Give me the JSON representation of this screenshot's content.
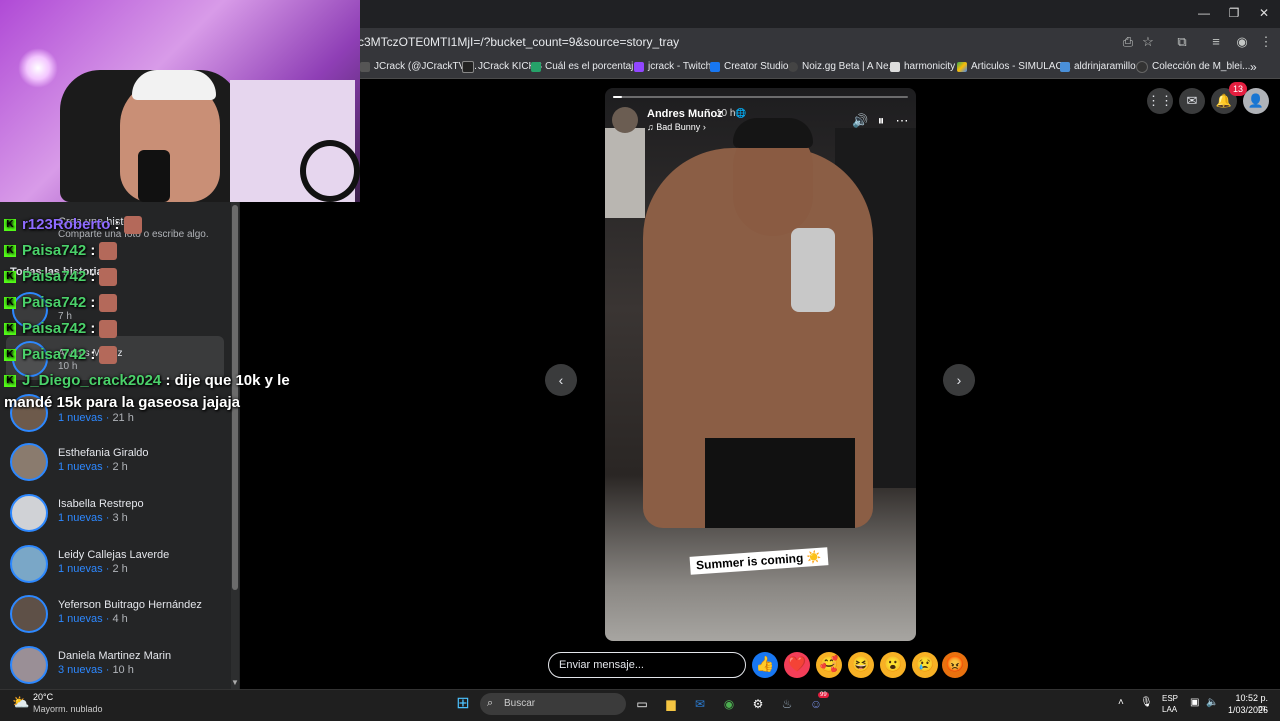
{
  "browser": {
    "url": "0Njc3MTczOTE0MTI1MjI=/?bucket_count=9&source=story_tray",
    "bookmarks": [
      "JCrack (@JCrackTV)...",
      "JCrack KICKS",
      "Cuál es el porcentaj...",
      "jcrack - Twitch",
      "Creator Studio",
      "Noiz.gg Beta | A Ne...",
      "harmonicity",
      "Articulos - SIMULAC...",
      "aldrinjaramillo",
      "Colección de M_blei..."
    ],
    "more_bookmarks": "»"
  },
  "facebook": {
    "notification_count": "13",
    "sidebar_faded": {
      "create_title": "Crea una historia",
      "create_sub": "Comparte una foto o escribe algo.",
      "all_stories": "Todas las historia",
      "row1_time": "7 h",
      "row2_name": "Andres Muñoz",
      "row2_time": "10 h"
    },
    "stories": [
      {
        "name": "",
        "new": "1 nuevas",
        "time": "21 h"
      },
      {
        "name": "Esthefania Giraldo",
        "new": "1 nuevas",
        "time": "2 h"
      },
      {
        "name": "Isabella Restrepo",
        "new": "1 nuevas",
        "time": "3 h"
      },
      {
        "name": "Leidy Callejas Laverde",
        "new": "1 nuevas",
        "time": "2 h"
      },
      {
        "name": "Yeferson Buitrago Hernández",
        "new": "1 nuevas",
        "time": "4 h"
      },
      {
        "name": "Daniela Martinez Marin",
        "new": "3 nuevas",
        "time": "10 h"
      }
    ],
    "viewer": {
      "author": "Andres Muñoz",
      "time": "10 h",
      "music": "Bad Bunny",
      "caption": "Summer is coming ☀️",
      "progress": 0.03
    },
    "reply_placeholder": "Enviar mensaje...",
    "reactions": [
      "👍",
      "❤️",
      "🥰",
      "😆",
      "😮",
      "😢",
      "😡"
    ]
  },
  "chat": [
    {
      "user": "r123Roberto",
      "sep": " :",
      "msg": ""
    },
    {
      "user": "Paisa742",
      "sep": " :",
      "msg": ""
    },
    {
      "user": "Paisa742",
      "sep": " :",
      "msg": ""
    },
    {
      "user": "Paisa742",
      "sep": " :",
      "msg": ""
    },
    {
      "user": "Paisa742",
      "sep": " :",
      "msg": ""
    },
    {
      "user": "Paisa742",
      "sep": " :",
      "msg": ""
    },
    {
      "user": "J_Diego_crack2024",
      "sep": " :",
      "msg": " dije que 10k y le"
    },
    {
      "user": "",
      "sep": "",
      "msg": "mandé 15k para la gaseosa jajaja"
    }
  ],
  "taskbar": {
    "temp": "20°C",
    "weather": "Mayorm. nublado",
    "search": "Buscar",
    "lang": "ESP",
    "region": "LAA",
    "time": "10:52 p. m.",
    "date": "1/03/2026",
    "discord_badge": "99"
  }
}
